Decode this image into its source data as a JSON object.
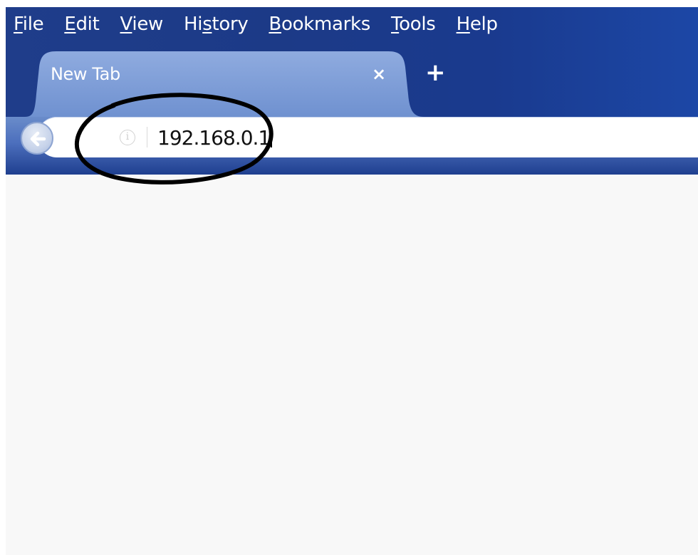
{
  "menubar": {
    "items": [
      {
        "mnemonic": "F",
        "rest": "ile"
      },
      {
        "mnemonic": "E",
        "rest": "dit"
      },
      {
        "mnemonic": "V",
        "rest": "iew"
      },
      {
        "pre": "Hi",
        "mnemonic": "s",
        "rest": "tory"
      },
      {
        "mnemonic": "B",
        "rest": "ookmarks"
      },
      {
        "mnemonic": "T",
        "rest": "ools"
      },
      {
        "mnemonic": "H",
        "rest": "elp"
      }
    ]
  },
  "tabs": [
    {
      "title": "New Tab",
      "close_icon": "×"
    }
  ],
  "newtab_icon": "+",
  "urlbar": {
    "url": "192.168.0.1",
    "info_icon": "i"
  },
  "colors": {
    "chrome": "#1f3d8a",
    "tab": "#7b9bd6",
    "content_bg": "#f8f8f8"
  },
  "icons": [
    "back-arrow-icon",
    "info-icon",
    "close-icon",
    "plus-icon"
  ]
}
